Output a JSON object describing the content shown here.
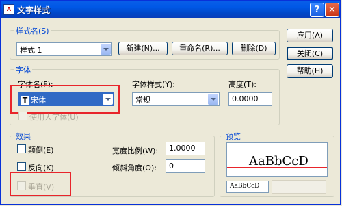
{
  "window": {
    "title": "文字样式",
    "icon_text": "A"
  },
  "title_buttons": {
    "help": "?",
    "close": "✕"
  },
  "style_name": {
    "group_label": "样式名(S)",
    "value": "样式 1",
    "new_btn": "新建(N)...",
    "rename_btn": "重命名(R)...",
    "delete_btn": "删除(D)"
  },
  "side_buttons": {
    "apply": "应用(A)",
    "close": "关闭(C)",
    "help": "帮助(H)"
  },
  "font": {
    "group_label": "字体",
    "font_name_label": "字体名(F):",
    "font_name_value": "宋体",
    "font_name_icon": "T",
    "font_style_label": "字体样式(Y):",
    "font_style_value": "常规",
    "height_label": "高度(T):",
    "height_value": "0.0000",
    "use_bigfont": "使用大字体(U)"
  },
  "effects": {
    "group_label": "效果",
    "upside_down": "颠倒(E)",
    "backwards": "反向(K)",
    "vertical": "垂直(V)",
    "width_factor_label": "宽度比例(W):",
    "width_factor_value": "1.0000",
    "oblique_label": "倾斜角度(O):",
    "oblique_value": "0"
  },
  "preview": {
    "group_label": "预览",
    "sample_text": "AaBbCcD",
    "input_value": "AaBbCcD"
  },
  "colors": {
    "highlight_border": "#e8252b",
    "selection": "#316ac5"
  }
}
